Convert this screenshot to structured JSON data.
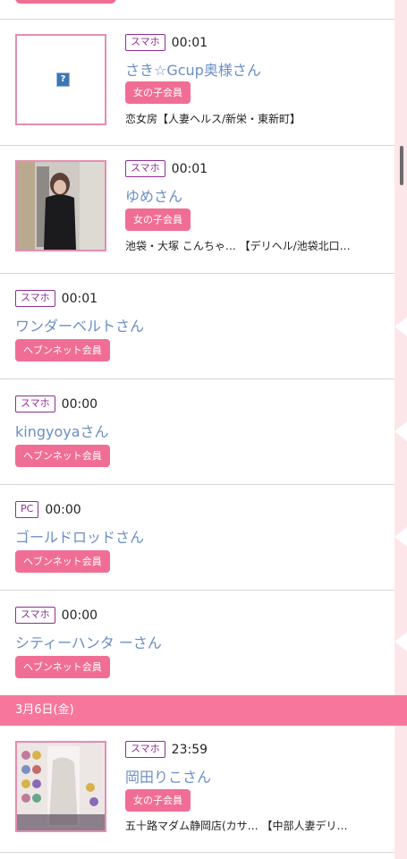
{
  "date_header": "3月6日(金)",
  "entries": [
    {
      "device": "スマホ",
      "time": "00:01",
      "name": "さき☆Gcup奥様さん",
      "badge": "女の子会員",
      "shop": "恋女房【人妻ヘルス/新栄・東新町】"
    },
    {
      "device": "スマホ",
      "time": "00:01",
      "name": "ゆめさん",
      "badge": "女の子会員",
      "shop": "池袋・大塚 こんちゃ… 【デリヘル/池袋北口…"
    },
    {
      "device": "スマホ",
      "time": "00:01",
      "name": "ワンダーベルトさん",
      "badge": "ヘブンネット会員"
    },
    {
      "device": "スマホ",
      "time": "00:00",
      "name": "kingyoyaさん",
      "badge": "ヘブンネット会員"
    },
    {
      "device": "PC",
      "time": "00:00",
      "name": "ゴールドロッドさん",
      "badge": "ヘブンネット会員"
    },
    {
      "device": "スマホ",
      "time": "00:00",
      "name": "シティーハンタ ーさん",
      "badge": "ヘブンネット会員"
    },
    {
      "device": "スマホ",
      "time": "23:59",
      "name": "岡田りこさん",
      "badge": "女の子会員",
      "shop": "五十路マダム静岡店(カサ… 【中部人妻デリ…"
    }
  ],
  "broken_image_glyph": "?",
  "colors": {
    "accent": "#f06e95",
    "date_bar": "#f7779c",
    "name": "#6b8ec4",
    "device_border": "#8e2f93"
  }
}
